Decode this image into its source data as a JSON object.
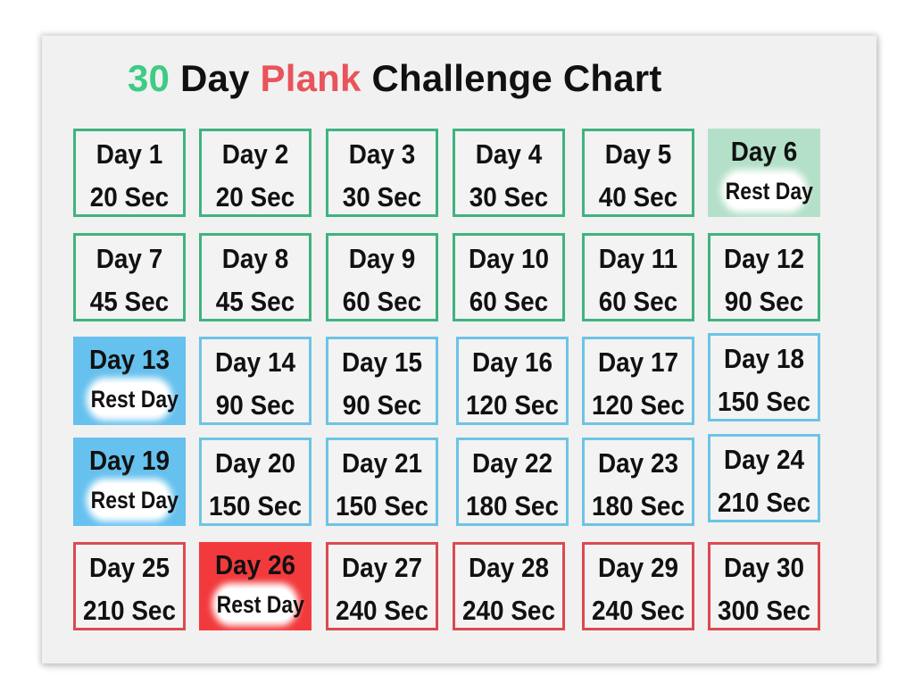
{
  "title": {
    "part1": "30",
    "part2": " Day ",
    "part3": "Plank",
    "part4": " Challenge Chart"
  },
  "colors": {
    "title_number": "#3ecb85",
    "title_accent": "#e8545a",
    "week_group_1": "#3fb37f",
    "week_group_2": "#6cc4e6",
    "week_group_3": "#dc4a4e",
    "rest_fill_1": "#b4e0c9",
    "rest_fill_2": "#66c1ee",
    "rest_fill_3": "#f23a3c"
  },
  "days": [
    {
      "day": "Day 1",
      "duration": "20 Sec",
      "seconds": 20,
      "rest": false,
      "group": "green"
    },
    {
      "day": "Day 2",
      "duration": "20 Sec",
      "seconds": 20,
      "rest": false,
      "group": "green"
    },
    {
      "day": "Day 3",
      "duration": "30 Sec",
      "seconds": 30,
      "rest": false,
      "group": "green"
    },
    {
      "day": "Day 4",
      "duration": "30 Sec",
      "seconds": 30,
      "rest": false,
      "group": "green"
    },
    {
      "day": "Day 5",
      "duration": "40 Sec",
      "seconds": 40,
      "rest": false,
      "group": "green"
    },
    {
      "day": "Day 6",
      "duration": "Rest Day",
      "seconds": 0,
      "rest": true,
      "group": "green"
    },
    {
      "day": "Day 7",
      "duration": "45 Sec",
      "seconds": 45,
      "rest": false,
      "group": "green"
    },
    {
      "day": "Day 8",
      "duration": "45 Sec",
      "seconds": 45,
      "rest": false,
      "group": "green"
    },
    {
      "day": "Day 9",
      "duration": "60 Sec",
      "seconds": 60,
      "rest": false,
      "group": "green"
    },
    {
      "day": "Day 10",
      "duration": "60 Sec",
      "seconds": 60,
      "rest": false,
      "group": "green"
    },
    {
      "day": "Day 11",
      "duration": "60 Sec",
      "seconds": 60,
      "rest": false,
      "group": "green"
    },
    {
      "day": "Day 12",
      "duration": "90 Sec",
      "seconds": 90,
      "rest": false,
      "group": "green"
    },
    {
      "day": "Day 13",
      "duration": "Rest Day",
      "seconds": 0,
      "rest": true,
      "group": "blue"
    },
    {
      "day": "Day 14",
      "duration": "90 Sec",
      "seconds": 90,
      "rest": false,
      "group": "blue"
    },
    {
      "day": "Day 15",
      "duration": "90 Sec",
      "seconds": 90,
      "rest": false,
      "group": "blue"
    },
    {
      "day": "Day 16",
      "duration": "120 Sec",
      "seconds": 120,
      "rest": false,
      "group": "blue"
    },
    {
      "day": "Day 17",
      "duration": "120 Sec",
      "seconds": 120,
      "rest": false,
      "group": "blue"
    },
    {
      "day": "Day 18",
      "duration": "150 Sec",
      "seconds": 150,
      "rest": false,
      "group": "blue"
    },
    {
      "day": "Day 19",
      "duration": "Rest Day",
      "seconds": 0,
      "rest": true,
      "group": "blue"
    },
    {
      "day": "Day 20",
      "duration": "150 Sec",
      "seconds": 150,
      "rest": false,
      "group": "blue"
    },
    {
      "day": "Day 21",
      "duration": "150 Sec",
      "seconds": 150,
      "rest": false,
      "group": "blue"
    },
    {
      "day": "Day 22",
      "duration": "180 Sec",
      "seconds": 180,
      "rest": false,
      "group": "blue"
    },
    {
      "day": "Day 23",
      "duration": "180 Sec",
      "seconds": 180,
      "rest": false,
      "group": "blue"
    },
    {
      "day": "Day 24",
      "duration": "210 Sec",
      "seconds": 210,
      "rest": false,
      "group": "blue"
    },
    {
      "day": "Day 25",
      "duration": "210 Sec",
      "seconds": 210,
      "rest": false,
      "group": "red"
    },
    {
      "day": "Day 26",
      "duration": "Rest Day",
      "seconds": 0,
      "rest": true,
      "group": "red"
    },
    {
      "day": "Day 27",
      "duration": "240 Sec",
      "seconds": 240,
      "rest": false,
      "group": "red"
    },
    {
      "day": "Day 28",
      "duration": "240 Sec",
      "seconds": 240,
      "rest": false,
      "group": "red"
    },
    {
      "day": "Day 29",
      "duration": "240 Sec",
      "seconds": 240,
      "rest": false,
      "group": "red"
    },
    {
      "day": "Day 30",
      "duration": "300 Sec",
      "seconds": 300,
      "rest": false,
      "group": "red"
    }
  ]
}
